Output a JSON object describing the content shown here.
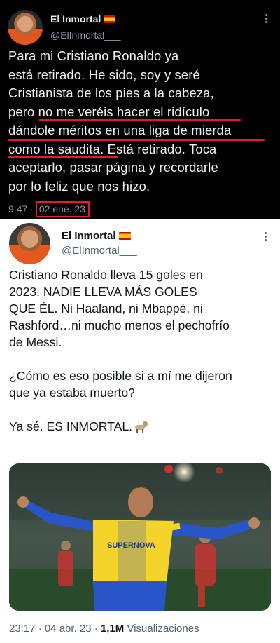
{
  "colors": {
    "dark_bg": "#000000",
    "light_bg": "#ffffff",
    "highlight_red": "#e8192c",
    "muted_dark": "#8b98a5",
    "muted_light": "#536471"
  },
  "tweet1": {
    "display_name": "El Inmortal",
    "handle": "@ElInmortal___",
    "text_lines": [
      "Para mi Cristiano Ronaldo ya",
      "está retirado. He sido, soy y seré",
      "Cristianista de los pies a la cabeza,",
      "pero no me veréis hacer el ridículo",
      "dándole méritos en una liga de mierda",
      "como la saudita. Está retirado. Toca",
      "aceptarlo, pasar página y recordarle",
      "por lo feliz que nos hizo."
    ],
    "time": "9:47 ·",
    "date": "02 ene. 23"
  },
  "tweet2": {
    "display_name": "El Inmortal",
    "handle": "@ElInmortal___",
    "text_lines": [
      "Cristiano Ronaldo lleva 15 goles en",
      "2023. NADIE LLEVA MÁS GOLES",
      "QUE ÉL. Ni Haaland, ni Mbappé, ni",
      "Rashford…ni mucho menos el pechofrío",
      "de Messi.",
      "",
      "¿Cómo es eso posible si a mí me dijeron",
      "que ya estaba muerto?",
      "",
      "Ya sé. ES INMORTAL."
    ],
    "goat_icon": "goat-emoji",
    "photo_icon": "football-player-photo",
    "jersey_text": "SUPERNOVA",
    "time_date": "23:17 · 04 abr. 23 ·",
    "views_count": "1,1M",
    "views_label": "Visualizaciones"
  }
}
